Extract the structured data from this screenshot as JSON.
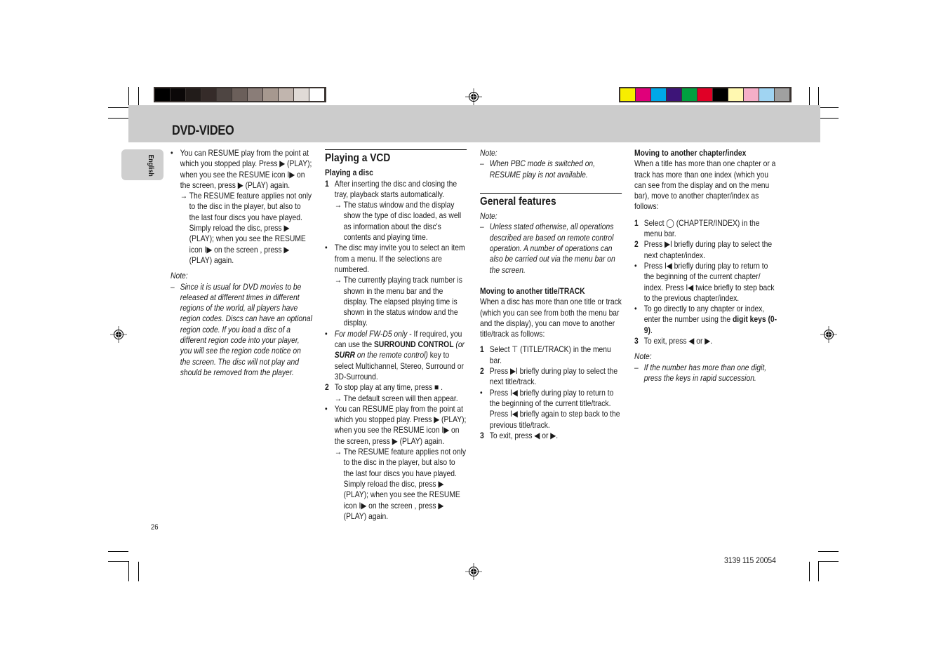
{
  "color_bars": {
    "grayscale": [
      "#000000",
      "#0b0808",
      "#221c1a",
      "#352b29",
      "#4e4542",
      "#6b5f5a",
      "#8a7d78",
      "#a6988f",
      "#c1b5ae",
      "#e0dad6",
      "#ffffff"
    ],
    "colors": [
      "#f7ee00",
      "#e0007a",
      "#00a8e8",
      "#3d1478",
      "#00a040",
      "#e00026",
      "#000000",
      "#fff8b0",
      "#f5afc8",
      "#a0d4f2",
      "#a0a0a0"
    ]
  },
  "header": {
    "section_title": "DVD-VIDEO",
    "language_tab": "English"
  },
  "page_number": "26",
  "document_code": "3139 115 20054",
  "icons": {
    "play": "▶",
    "resume": "I▶",
    "stop": "■",
    "next": "▶I",
    "prev": "I◀",
    "left": "◀",
    "right": "▶",
    "title_track": "⊤",
    "chapter_index": "◯",
    "bullet": "•",
    "arrow": "→",
    "dash": "–"
  },
  "col1": {
    "bullet1": "You can RESUME play from the point at which you stopped play. Press ▶ (PLAY); when you see the RESUME icon I▶ on the screen, press ▶ (PLAY) again.",
    "arrow1": "The RESUME feature applies not only to the disc in the player, but also to the last four discs you have played. Simply reload the disc, press ▶ (PLAY); when you see the RESUME icon I▶ on the screen , press ▶ (PLAY) again.",
    "note_label": "Note:",
    "note_text": "Since it is usual for DVD movies to be released at different times in different regions of the world, all players have region codes. Discs can have an optional region code. If you load a disc of a different region code into your player, you will see the region code notice on the screen. The disc will not play and should be removed from the player."
  },
  "col2": {
    "heading": "Playing a VCD",
    "subheading": "Playing a disc",
    "step1_num": "1",
    "step1": "After inserting the disc and closing the tray, playback starts automatically.",
    "step1_arrow": "The status window and the  display show the type of disc loaded, as well as information about the disc's contents and playing time.",
    "bullet_menu": "The disc may invite you to select an item from a menu. If the selections are numbered.",
    "bullet_menu_arrow": "The currently playing track number is shown in the menu bar and the display. The elapsed playing time is shown in the status window and the display.",
    "model_italic": "For model FW-D5 only",
    "model_text1": " - If required, you can use the ",
    "model_bold": "SURROUND CONTROL",
    "model_italic2": " (or ",
    "model_bold2": "SURR",
    "model_italic3": " on the remote control)",
    "model_text2": " key to select Multichannel, Stereo, Surround or 3D-Surround.",
    "step2_num": "2",
    "step2": "To stop play at any time, press ■ .",
    "step2_arrow": "The default screen will then appear.",
    "bullet_resume": "You can RESUME play from the point at which you stopped play. Press ▶ (PLAY); when you see the RESUME icon I▶ on the screen, press ▶ (PLAY) again.",
    "bullet_resume_arrow": "The RESUME feature applies not only to the disc in the player, but also to the last four discs you have played. Simply reload the disc, press ▶ (PLAY); when you see the RESUME icon I▶ on the screen , press ▶ (PLAY) again."
  },
  "col3": {
    "note_label": "Note:",
    "note_pbc": "When PBC mode is switched on, RESUME play is not available.",
    "heading": "General features",
    "note2_label": "Note:",
    "note2": "Unless stated otherwise, all operations described are based on remote control operation. A number of operations can also be carried out via the menu bar on the screen.",
    "subheading": "Moving to another title/TRACK",
    "intro": "When a disc has more than one title or track (which you can see from both the menu bar and the display), you can move to another title/track as follows:",
    "step1_num": "1",
    "step1": "Select ⊤ (TITLE/TRACK) in the menu bar.",
    "step2_num": "2",
    "step2": "Press ▶I  briefly during play to select the next title/track.",
    "bullet": "Press I◀ briefly during play to return to the beginning of the current title/track. Press I◀ briefly again to step back to the previous title/track.",
    "step3_num": "3",
    "step3": "To exit, press ◀ or ▶."
  },
  "col4": {
    "subheading": "Moving to another chapter/index",
    "intro": "When a title has more than one chapter or a track has more than one index (which you can see from the display and on the menu bar), move to another chapter/index as follows:",
    "step1_num": "1",
    "step1": "Select ◯ (CHAPTER/INDEX) in the menu bar.",
    "step2_num": "2",
    "step2": "Press ▶I briefly during play to select the next chapter/index.",
    "bullet1": "Press I◀ briefly during play to return to the beginning of the current chapter/ index. Press I◀ twice briefly to step back to the previous chapter/index.",
    "bullet2_text": "To go directly to any chapter or index, enter the number using the ",
    "bullet2_bold": "digit keys (0-9)",
    "bullet2_end": ".",
    "step3_num": "3",
    "step3": "To exit, press ◀ or ▶.",
    "note_label": "Note:",
    "note": "If the number has more than one digit, press the keys in rapid succession."
  }
}
